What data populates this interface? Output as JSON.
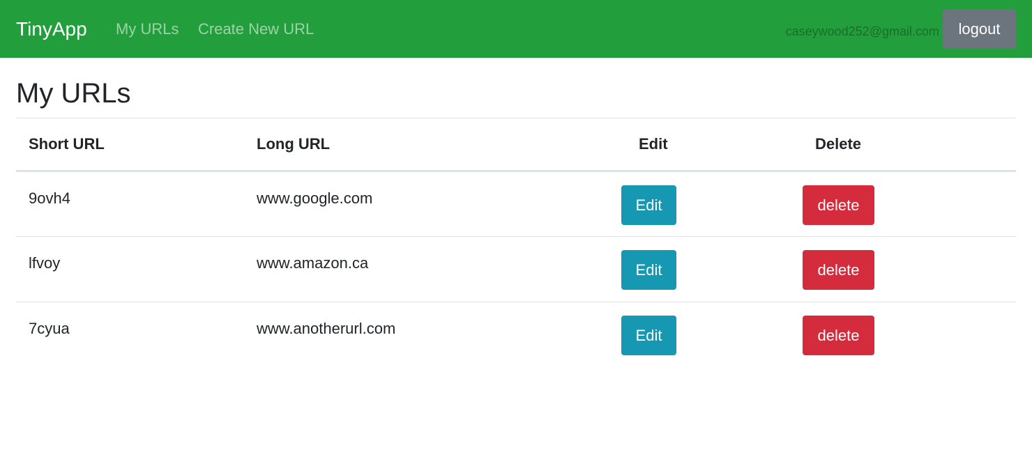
{
  "navbar": {
    "brand": "TinyApp",
    "links": [
      {
        "label": "My URLs"
      },
      {
        "label": "Create New URL"
      }
    ],
    "user_email": "caseywood252@gmail.com",
    "logout_label": "logout",
    "background_color": "#239e3c"
  },
  "page": {
    "title": "My URLs"
  },
  "table": {
    "headers": [
      "Short URL",
      "Long URL",
      "Edit",
      "Delete"
    ],
    "rows": [
      {
        "short_url": "9ovh4",
        "long_url": "www.google.com",
        "edit_label": "Edit",
        "delete_label": "delete"
      },
      {
        "short_url": "lfvoy",
        "long_url": "www.amazon.ca",
        "edit_label": "Edit",
        "delete_label": "delete"
      },
      {
        "short_url": "7cyua",
        "long_url": "www.anotherurl.com",
        "edit_label": "Edit",
        "delete_label": "delete"
      }
    ]
  },
  "colors": {
    "edit_button": "#1798b2",
    "delete_button": "#d42b3d",
    "logout_button": "#6c757d"
  }
}
